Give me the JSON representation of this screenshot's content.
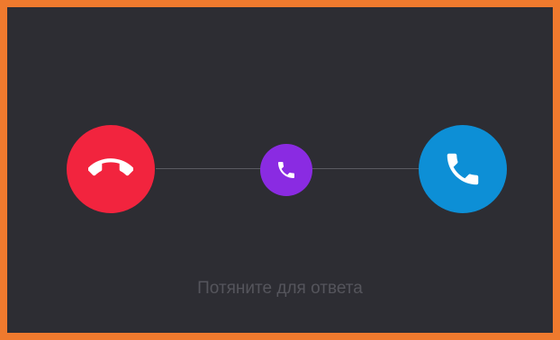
{
  "call_screen": {
    "hint_text": "Потяните для ответа",
    "buttons": {
      "decline": {
        "icon": "phone-hangup-icon",
        "color": "#f2243e"
      },
      "slider_handle": {
        "icon": "phone-icon",
        "color": "#8a2be2"
      },
      "accept": {
        "icon": "phone-icon",
        "color": "#0d8fd6"
      }
    },
    "colors": {
      "background": "#2d2d33",
      "border": "#ef7a2e",
      "track": "#5a5a61",
      "hint_text": "#55555c"
    }
  }
}
